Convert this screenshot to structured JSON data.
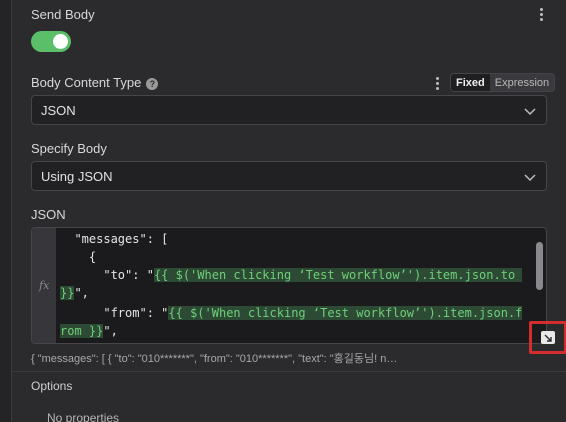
{
  "send_body": {
    "label": "Send Body",
    "enabled": true
  },
  "body_content_type": {
    "label": "Body Content Type",
    "mode_fixed": "Fixed",
    "mode_expression": "Expression",
    "value": "JSON"
  },
  "specify_body": {
    "label": "Specify Body",
    "value": "Using JSON"
  },
  "json_field": {
    "label": "JSON",
    "fx": "fx",
    "lines": [
      {
        "indent": "  ",
        "text": "\"messages\": ["
      },
      {
        "indent": "    ",
        "text": "{"
      },
      {
        "indent": "      ",
        "key": "\"to\": \"",
        "expr": "{{ $('When clicking ‘Test workflow’').item.json.to ",
        "after": ""
      },
      {
        "indent": "",
        "key": "",
        "expr": "}}",
        "after": "\","
      },
      {
        "indent": "      ",
        "key": "\"from\": \"",
        "expr": "{{ $('When clicking ‘Test workflow’').item.json.f",
        "after": ""
      },
      {
        "indent": "",
        "key": "",
        "expr": "rom }}",
        "after": "\","
      }
    ],
    "preview": "{   \"messages\": [     {       \"to\": \"010*******\",       \"from\": \"010*******\",       \"text\": \"홍길동님! n…"
  },
  "options": {
    "label": "Options",
    "empty_text": "No properties"
  },
  "icons": {
    "kebab": "kebab-menu-icon",
    "help": "help-icon",
    "chevron": "chevron-down-icon",
    "expand": "expand-editor-icon"
  },
  "colors": {
    "toggle_on": "#5bbf6a",
    "expression_green": "#6fd07a",
    "highlight_red": "#d42d2d"
  }
}
